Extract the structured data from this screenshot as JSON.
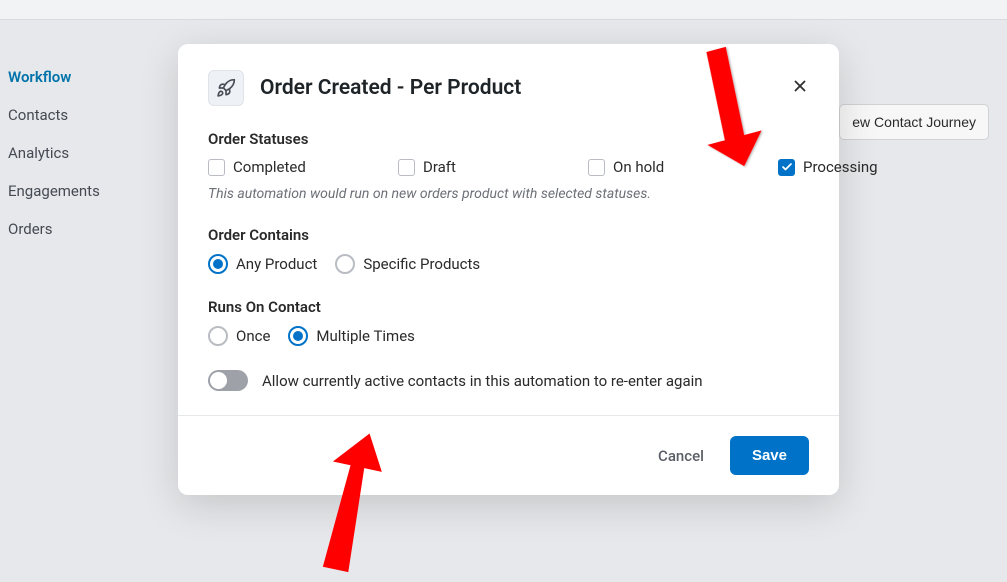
{
  "sidebar": {
    "items": [
      {
        "label": "Workflow",
        "active": true
      },
      {
        "label": "Contacts",
        "active": false
      },
      {
        "label": "Analytics",
        "active": false
      },
      {
        "label": "Engagements",
        "active": false
      },
      {
        "label": "Orders",
        "active": false
      }
    ]
  },
  "header_button": "ew Contact Journey",
  "modal": {
    "title": "Order Created - Per Product",
    "sections": {
      "order_statuses": {
        "label": "Order Statuses",
        "options": [
          {
            "label": "Completed",
            "checked": false
          },
          {
            "label": "Draft",
            "checked": false
          },
          {
            "label": "On hold",
            "checked": false
          },
          {
            "label": "Processing",
            "checked": true
          }
        ],
        "help": "This automation would run on new orders product with selected statuses."
      },
      "order_contains": {
        "label": "Order Contains",
        "options": [
          {
            "label": "Any Product",
            "selected": true
          },
          {
            "label": "Specific Products",
            "selected": false
          }
        ]
      },
      "runs_on_contact": {
        "label": "Runs On Contact",
        "options": [
          {
            "label": "Once",
            "selected": false
          },
          {
            "label": "Multiple Times",
            "selected": true
          }
        ]
      },
      "reenter": {
        "label": "Allow currently active contacts in this automation to re-enter again",
        "enabled": false
      }
    },
    "footer": {
      "cancel": "Cancel",
      "save": "Save"
    }
  }
}
